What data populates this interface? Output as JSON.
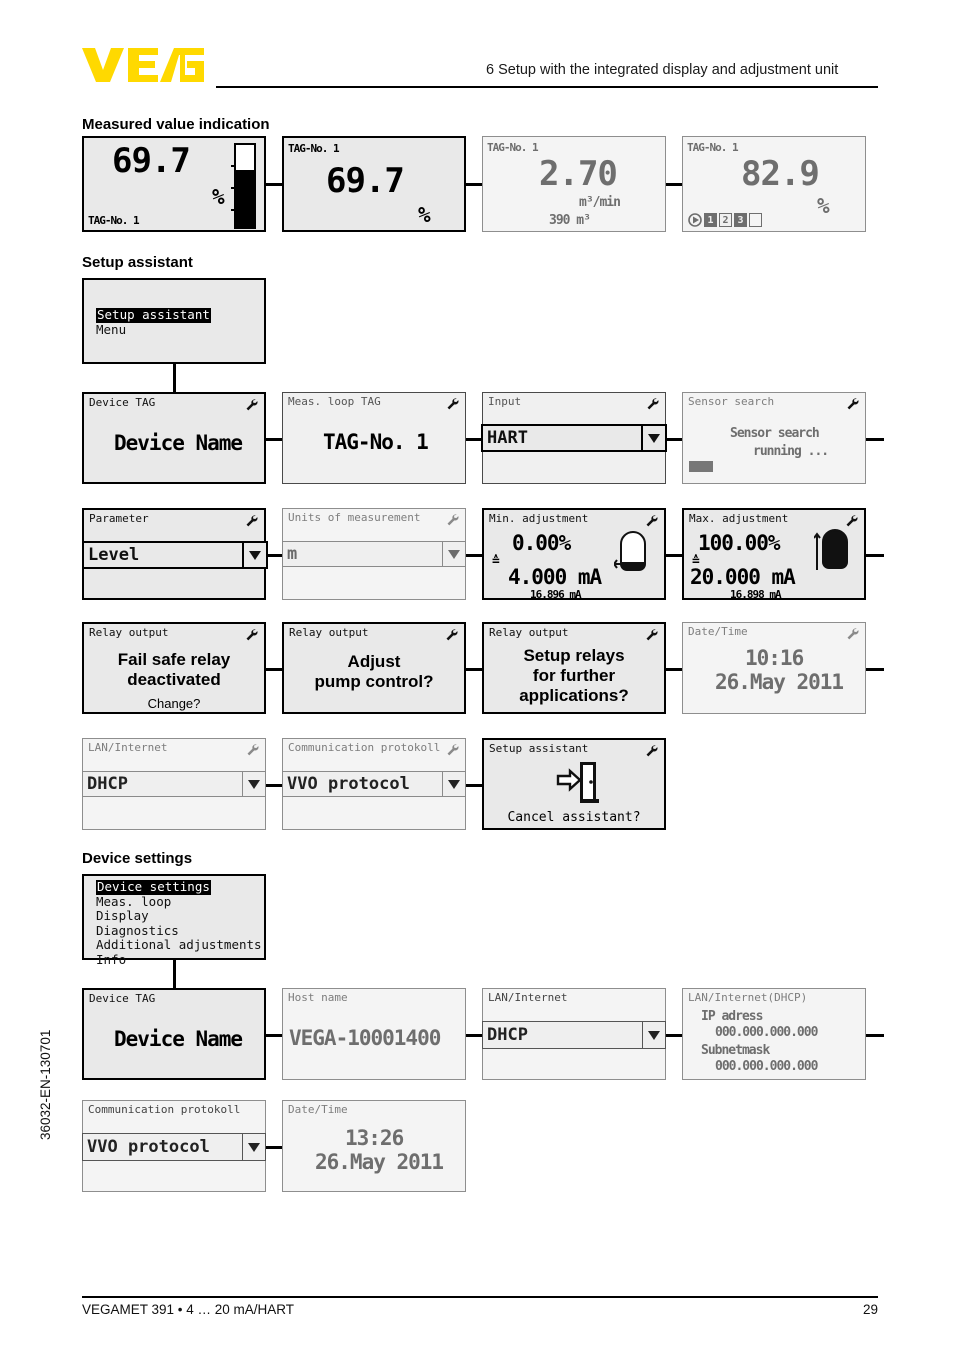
{
  "header": {
    "logo_text": "VEGA",
    "logo_color": "#ffd900",
    "chapter_title": "6 Setup with the integrated display and adjustment unit"
  },
  "sections": {
    "measured_value": "Measured value indication",
    "setup_assistant": "Setup assistant",
    "device_settings": "Device settings"
  },
  "measured_value_screens": [
    {
      "tag": "TAG-No. 1",
      "value": "69.7",
      "unit": "%",
      "bar_percent": 70
    },
    {
      "tag": "TAG-No. 1",
      "value": "69.7",
      "unit": "%"
    },
    {
      "tag": "TAG-No. 1",
      "value": "2.70",
      "unit": "m³/min",
      "totalizer": "390 m³"
    },
    {
      "tag": "TAG-No. 1",
      "value": "82.9",
      "unit": "%",
      "relays": [
        "1",
        "2",
        "3",
        ""
      ]
    }
  ],
  "assistant_menu": {
    "selected": "Setup assistant",
    "item2": "Menu"
  },
  "assistant_screens": {
    "device_tag": {
      "title": "Device TAG",
      "value": "Device Name"
    },
    "meas_loop_tag": {
      "title": "Meas. loop TAG",
      "value": "TAG-No. 1"
    },
    "input": {
      "title": "Input",
      "value": "HART"
    },
    "sensor_search": {
      "title": "Sensor search",
      "line1": "Sensor search",
      "line2": "running ..."
    },
    "parameter": {
      "title": "Parameter",
      "value": "Level"
    },
    "units": {
      "title": "Units of measurement",
      "value": "m"
    },
    "min_adjust": {
      "title": "Min. adjustment",
      "percent": "0.00%",
      "equals": "≙",
      "current": "4.000 mA",
      "actual": "16.896 mA"
    },
    "max_adjust": {
      "title": "Max. adjustment",
      "percent": "100.00%",
      "equals": "≙",
      "current": "20.000 mA",
      "actual": "16.898 mA"
    },
    "relay_failsafe": {
      "title": "Relay output",
      "line1": "Fail safe relay",
      "line2": "deactivated",
      "prompt": "Change?"
    },
    "relay_pump": {
      "title": "Relay output",
      "line1": "Adjust",
      "line2": "pump control?"
    },
    "relay_further": {
      "title": "Relay output",
      "line1": "Setup relays",
      "line2": "for further",
      "line3": "applications?"
    },
    "date_time": {
      "title": "Date/Time",
      "time": "10:16",
      "date": "26.May 2011"
    },
    "lan": {
      "title": "LAN/Internet",
      "value": "DHCP"
    },
    "protocol": {
      "title": "Communication protokoll",
      "value": "VVO protocol"
    },
    "cancel": {
      "title": "Setup assistant",
      "prompt": "Cancel assistant?"
    }
  },
  "settings_menu": {
    "selected": "Device settings",
    "items": [
      "Meas. loop",
      "Display",
      "Diagnostics",
      "Additional adjustments",
      "Info"
    ]
  },
  "settings_screens": {
    "device_tag": {
      "title": "Device TAG",
      "value": "Device Name"
    },
    "host_name": {
      "title": "Host name",
      "value": "VEGA-10001400"
    },
    "lan": {
      "title": "LAN/Internet",
      "value": "DHCP"
    },
    "lan_dhcp": {
      "title": "LAN/Internet(DHCP)",
      "ip_label": "IP adress",
      "ip_value": "000.000.000.000",
      "mask_label": "Subnetmask",
      "mask_value": "000.000.000.000"
    },
    "protocol": {
      "title": "Communication protokoll",
      "value": "VVO protocol"
    },
    "date_time": {
      "title": "Date/Time",
      "time": "13:26",
      "date": "26.May 2011"
    }
  },
  "side_code": "36032-EN-130701",
  "footer": {
    "left": "VEGAMET 391 • 4 … 20 mA/HART",
    "page": "29"
  }
}
